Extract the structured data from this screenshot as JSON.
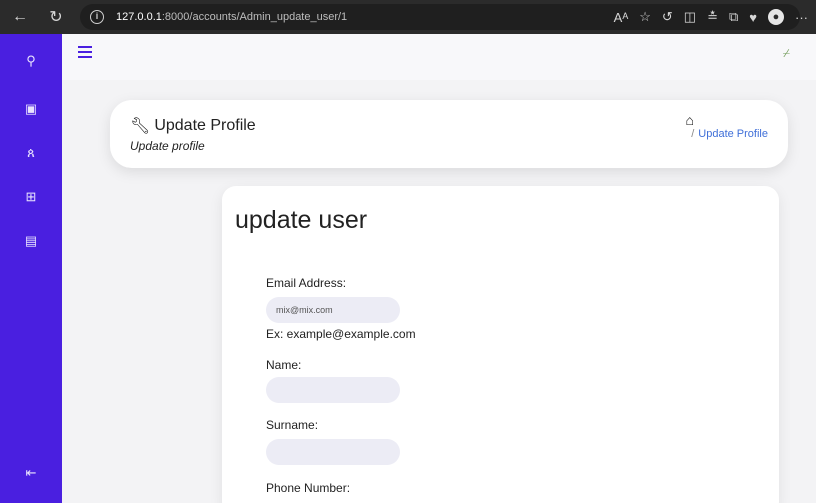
{
  "browser": {
    "url_host": "127.0.0.1",
    "url_rest": ":8000/accounts/Admin_update_user/1"
  },
  "header": {
    "title": "Update Profile",
    "subtitle": "Update profile",
    "breadcrumb_sep": "/",
    "breadcrumb_current": "Update Profile"
  },
  "form": {
    "title": "update user",
    "email_label": "Email Address:",
    "email_value": "mix@mix.com",
    "email_hint": "Ex: example@example.com",
    "name_label": "Name:",
    "name_value": "",
    "surname_label": "Surname:",
    "surname_value": "",
    "phone_label": "Phone Number:"
  },
  "colors": {
    "sidebar": "#4a1fe0",
    "breadcrumb_link": "#3f6fd8"
  }
}
